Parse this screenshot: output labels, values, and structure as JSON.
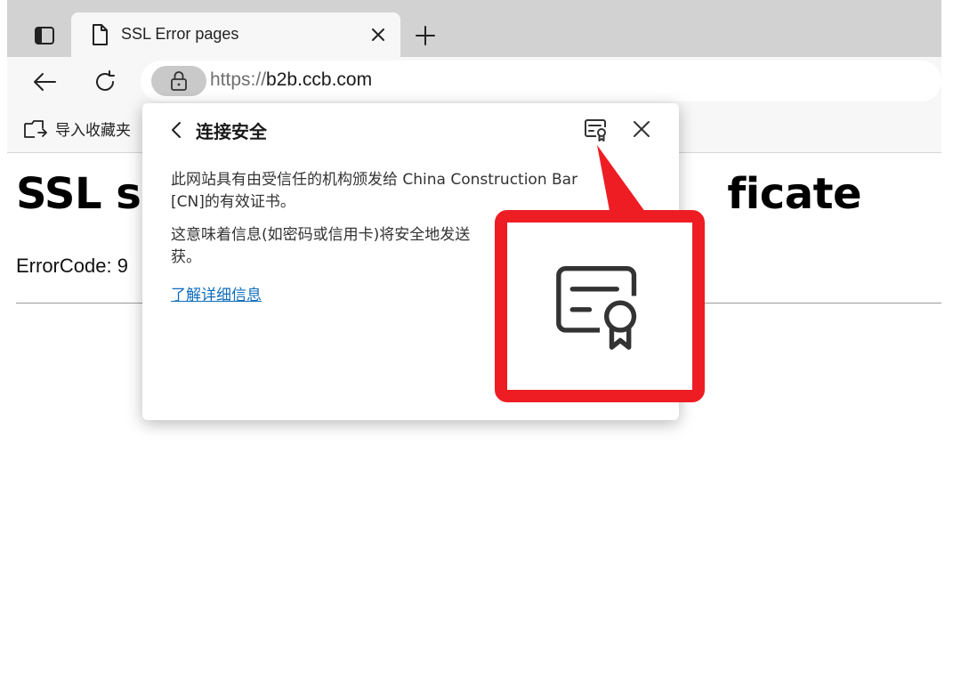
{
  "tab": {
    "title": "SSL Error pages"
  },
  "address": {
    "scheme": "https://",
    "host": "b2b.ccb.com"
  },
  "favorites": {
    "import_label": "导入收藏夹"
  },
  "page": {
    "heading_left": "SSL se",
    "heading_right": "ficate",
    "error_code": "ErrorCode: 9"
  },
  "flyout": {
    "title": "连接安全",
    "para1_line1": "此网站具有由受信任的机构颁发给 China Construction Bar",
    "para1_line2": "[CN]的有效证书。",
    "para2_line1": "这意味着信息(如密码或信用卡)将安全地发送",
    "para2_line2": "获。",
    "link": "了解详细信息"
  },
  "annotation": {
    "color": "#ee1d24",
    "icon": "certificate-icon"
  },
  "colors": {
    "link": "#0f6cbd",
    "tabstrip": "#d2d2d2",
    "toolbar": "#f7f7f7"
  }
}
